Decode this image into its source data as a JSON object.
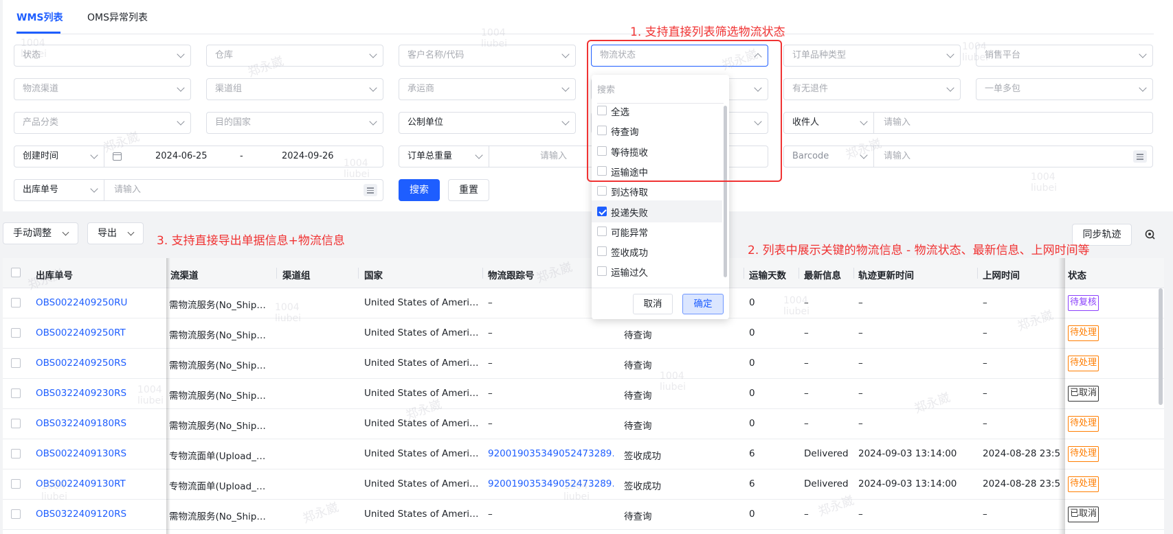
{
  "tabs": [
    {
      "label": "WMS列表"
    },
    {
      "label": "OMS异常列表"
    }
  ],
  "filters": {
    "status": "状态",
    "warehouse": "仓库",
    "customer": "客户名称/代码",
    "logistics_status": "物流状态",
    "order_type": "订单品种类型",
    "sales_platform": "销售平台",
    "logistics_channel": "物流渠道",
    "channel_group": "渠道组",
    "carrier": "承运商",
    "has_return": "有无退件",
    "multi_package": "一单多包",
    "product_category": "产品分类",
    "dest_country": "目的国家",
    "unit": "公制单位",
    "receiver_select": "收件人",
    "receiver_placeholder": "请输入",
    "date_type": "创建时间",
    "date_start": "2024-06-25",
    "date_sep": "-",
    "date_end": "2024-09-26",
    "weight_select": "订单总重量",
    "weight_placeholder": "请输入",
    "barcode_select": "Barcode",
    "barcode_placeholder": "请输入",
    "outbound_select": "出库单号",
    "outbound_placeholder": "请输入",
    "search_btn": "搜索",
    "reset_btn": "重置"
  },
  "toolbar": {
    "manual_adjust": "手动调整",
    "export": "导出",
    "sync_tracking": "同步轨迹"
  },
  "dropdown": {
    "search_placeholder": "搜索",
    "options": [
      {
        "label": "全选",
        "checked": false
      },
      {
        "label": "待查询",
        "checked": false
      },
      {
        "label": "等待揽收",
        "checked": false
      },
      {
        "label": "运输途中",
        "checked": false
      },
      {
        "label": "到达待取",
        "checked": false
      },
      {
        "label": "投递失败",
        "checked": true
      },
      {
        "label": "可能异常",
        "checked": false
      },
      {
        "label": "签收成功",
        "checked": false
      },
      {
        "label": "运输过久",
        "checked": false
      }
    ],
    "cancel": "取消",
    "confirm": "确定"
  },
  "table": {
    "headers": {
      "outbound_no": "出库单号",
      "channel": "流渠道",
      "channel_group": "渠道组",
      "country": "国家",
      "tracking_no": "物流跟踪号",
      "transit_days": "运输天数",
      "latest_info": "最新信息",
      "track_update": "轨迹更新时间",
      "online_time": "上网时间",
      "status": "状态"
    },
    "rows": [
      {
        "no": "OBS0022409250RU",
        "channel": "需物流服务(No_Ship…",
        "country": "United States of Ameri…",
        "tracking": "–",
        "logistics": "",
        "days": "0",
        "latest": "–",
        "update": "–",
        "online": "–",
        "status": "待复核",
        "status_color": "#8a3ffc"
      },
      {
        "no": "OBS0022409250RT",
        "channel": "需物流服务(No_Ship…",
        "country": "United States of Ameri…",
        "tracking": "–",
        "logistics": "待查询",
        "days": "0",
        "latest": "–",
        "update": "–",
        "online": "–",
        "status": "待处理",
        "status_color": "#ff7d00"
      },
      {
        "no": "OBS0022409250RS",
        "channel": "需物流服务(No_Ship…",
        "country": "United States of Ameri…",
        "tracking": "–",
        "logistics": "待查询",
        "days": "0",
        "latest": "–",
        "update": "–",
        "online": "–",
        "status": "待处理",
        "status_color": "#ff7d00"
      },
      {
        "no": "OBS0322409230RS",
        "channel": "需物流服务(No_Ship…",
        "country": "United States of Ameri…",
        "tracking": "–",
        "logistics": "待查询",
        "days": "0",
        "latest": "–",
        "update": "–",
        "online": "–",
        "status": "已取消",
        "status_color": "#333333"
      },
      {
        "no": "OBS0322409180RS",
        "channel": "需物流服务(No_Ship…",
        "country": "United States of Ameri…",
        "tracking": "–",
        "logistics": "待查询",
        "days": "0",
        "latest": "–",
        "update": "–",
        "online": "–",
        "status": "待处理",
        "status_color": "#ff7d00"
      },
      {
        "no": "OBS0022409130RS",
        "channel": "专物流面单(Upload_…",
        "country": "United States of Ameri…",
        "tracking": "920019035349052473289…",
        "logistics": "签收成功",
        "days": "6",
        "latest": "Delivered",
        "update": "2024-09-03 13:14:00",
        "online": "2024-08-28 23:5",
        "status": "待处理",
        "status_color": "#ff7d00"
      },
      {
        "no": "OBS0022409130RT",
        "channel": "专物流面单(Upload_…",
        "country": "United States of Ameri…",
        "tracking": "920019035349052473289…",
        "logistics": "签收成功",
        "days": "6",
        "latest": "Delivered",
        "update": "2024-09-03 13:14:00",
        "online": "2024-08-28 23:5",
        "status": "待处理",
        "status_color": "#ff7d00"
      },
      {
        "no": "OBS0322409120RS",
        "channel": "需物流服务(No_Ship…",
        "country": "United States of Ameri…",
        "tracking": "–",
        "logistics": "待查询",
        "days": "0",
        "latest": "–",
        "update": "–",
        "online": "–",
        "status": "已取消",
        "status_color": "#333333"
      }
    ]
  },
  "annotations": {
    "note1": "1. 支持直接列表筛选物流状态",
    "note2": "2. 列表中展示关键的物流信息 - 物流状态、最新信息、上网时间等",
    "note3": "3. 支持直接导出单据信息+物流信息"
  },
  "watermark": {
    "name": "郑永崴",
    "id": "1004",
    "user": "liubei"
  },
  "colors": {
    "accent": "#1e5eff",
    "annotation": "#f03232",
    "pending_review": "#8a3ffc",
    "pending": "#ff7d00",
    "cancelled": "#333333"
  }
}
